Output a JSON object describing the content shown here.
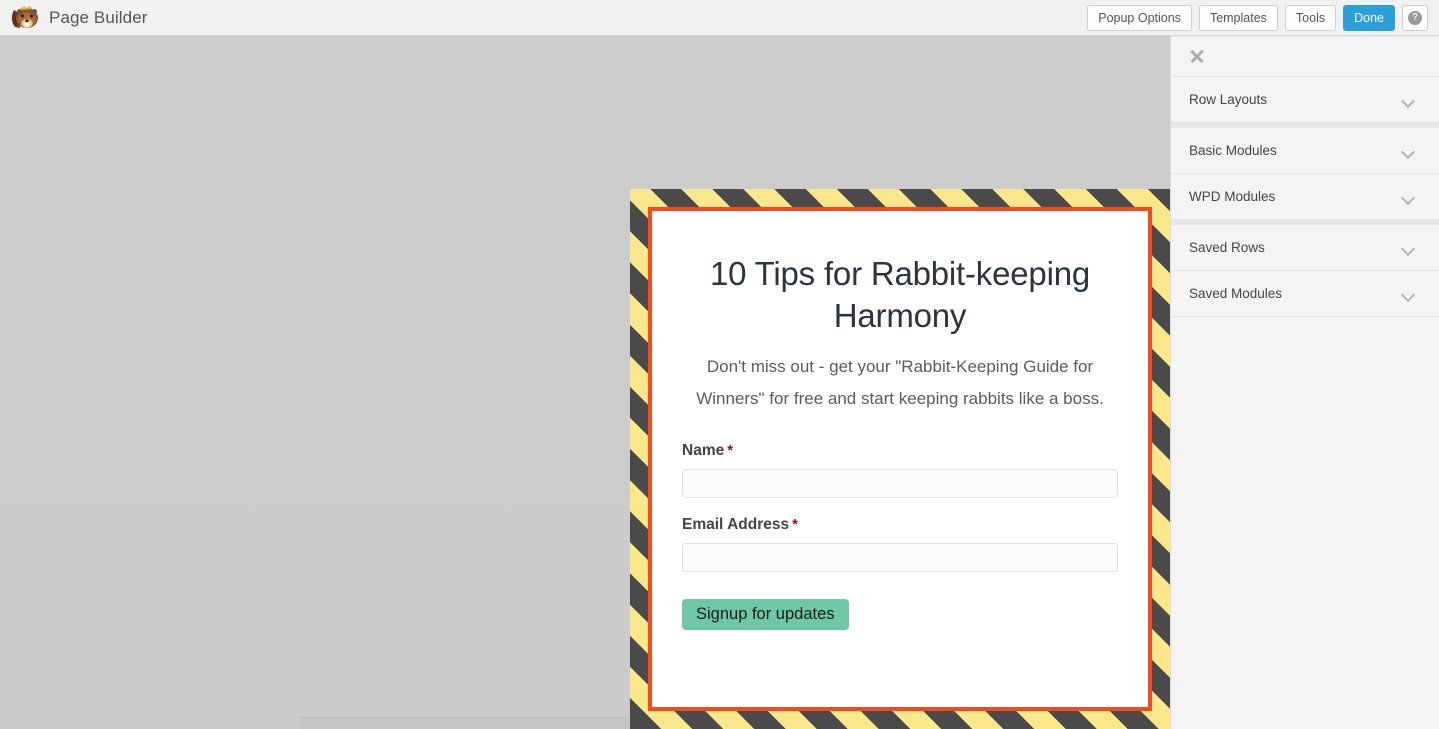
{
  "topbar": {
    "logo_icon": "beaver-logo-icon",
    "title": "Page Builder",
    "buttons": [
      {
        "label": "Popup Options",
        "name": "popup-options-button",
        "style": "default"
      },
      {
        "label": "Templates",
        "name": "templates-button",
        "style": "default"
      },
      {
        "label": "Tools",
        "name": "tools-button",
        "style": "default"
      },
      {
        "label": "Done",
        "name": "done-button",
        "style": "primary"
      }
    ],
    "help_button": {
      "icon": "help-circle-icon",
      "label": "?"
    },
    "accent_primary": "#2b9fd8",
    "bar_background": "#f1f1f1"
  },
  "canvas": {
    "background": "#cccccc"
  },
  "popup": {
    "border_stripe_colors": [
      "#fbe88c",
      "#4a4a4a"
    ],
    "inner_border_color": "#f54a1e",
    "heading": "10 Tips for Rabbit-keeping Harmony",
    "subheading": "Don't miss out - get your \"Rabbit-Keeping Guide for Winners\" for free and start keeping rabbits like a boss.",
    "form": {
      "fields": [
        {
          "label": "Name",
          "required_marker": "*",
          "value": "",
          "placeholder": "",
          "name": "name-field"
        },
        {
          "label": "Email Address",
          "required_marker": "*",
          "value": "",
          "placeholder": "",
          "name": "email-field"
        }
      ],
      "submit_label": "Signup for updates",
      "submit_color": "#6ec7a5"
    }
  },
  "sidebar": {
    "close_icon": "close-x-icon",
    "groups": [
      {
        "items": [
          {
            "label": "Row Layouts",
            "name": "sidebar-item-row-layouts",
            "chevron": "chevron-down-icon"
          }
        ]
      },
      {
        "items": [
          {
            "label": "Basic Modules",
            "name": "sidebar-item-basic-modules",
            "chevron": "chevron-down-icon"
          },
          {
            "label": "WPD Modules",
            "name": "sidebar-item-wpd-modules",
            "chevron": "chevron-down-icon"
          }
        ]
      },
      {
        "items": [
          {
            "label": "Saved Rows",
            "name": "sidebar-item-saved-rows",
            "chevron": "chevron-down-icon"
          },
          {
            "label": "Saved Modules",
            "name": "sidebar-item-saved-modules",
            "chevron": "chevron-down-icon"
          }
        ]
      }
    ]
  }
}
